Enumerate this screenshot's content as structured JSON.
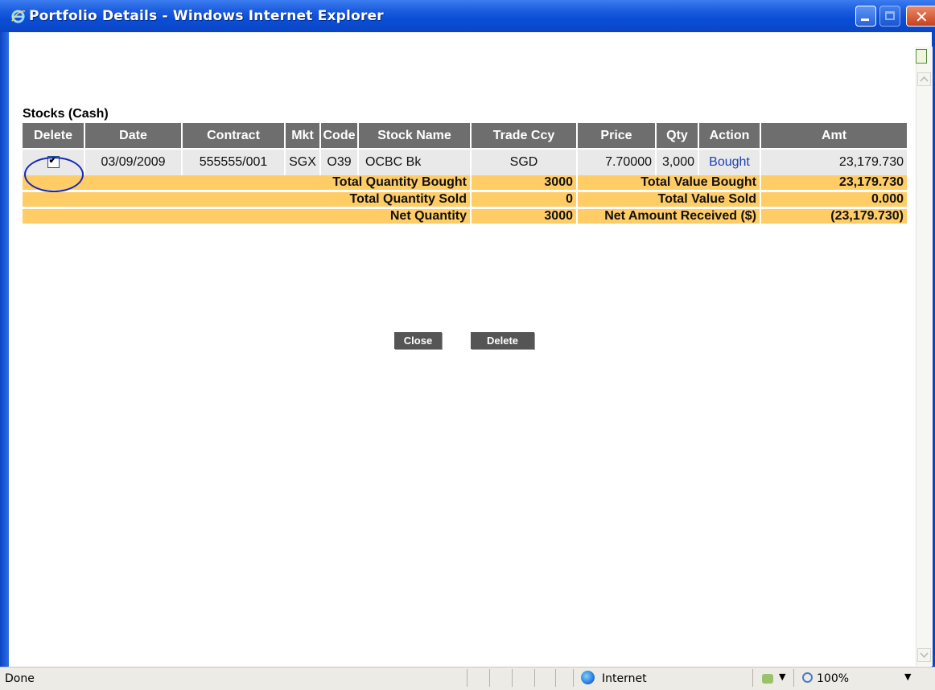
{
  "window": {
    "title": "Portfolio Details - Windows Internet Explorer"
  },
  "section": {
    "title": "Stocks (Cash)"
  },
  "table": {
    "columns": [
      "Delete",
      "Date",
      "Contract",
      "Mkt",
      "Code",
      "Stock Name",
      "Trade Ccy",
      "Price",
      "Qty",
      "Action",
      "Amt"
    ],
    "rows": [
      {
        "delete_checked": true,
        "date": "03/09/2009",
        "contract": "555555/001",
        "mkt": "SGX",
        "code": "O39",
        "stock_name": "OCBC Bk",
        "trade_ccy": "SGD",
        "price": "7.70000",
        "qty": "3,000",
        "action": "Bought",
        "amt": "23,179.730"
      }
    ]
  },
  "summary": {
    "total_qty_bought_label": "Total Quantity Bought",
    "total_qty_bought": "3000",
    "total_value_bought_label": "Total Value Bought",
    "total_value_bought": "23,179.730",
    "total_qty_sold_label": "Total Quantity Sold",
    "total_qty_sold": "0",
    "total_value_sold_label": "Total Value Sold",
    "total_value_sold": "0.000",
    "net_qty_label": "Net Quantity",
    "net_qty": "3000",
    "net_amount_label": "Net Amount Received ($)",
    "net_amount": "(23,179.730)"
  },
  "buttons": {
    "close": "Close",
    "delete": "Delete"
  },
  "statusbar": {
    "status": "Done",
    "zone": "Internet",
    "zoom": "100%"
  },
  "icons": {
    "browser": "ie-logo-icon",
    "checkbox_mark": "✔"
  },
  "colors": {
    "header_bg": "#6e6e6e",
    "summary_bg": "#ffcc66",
    "titlebar": "#0a4ed6",
    "annotation_circle": "#1528b8"
  }
}
